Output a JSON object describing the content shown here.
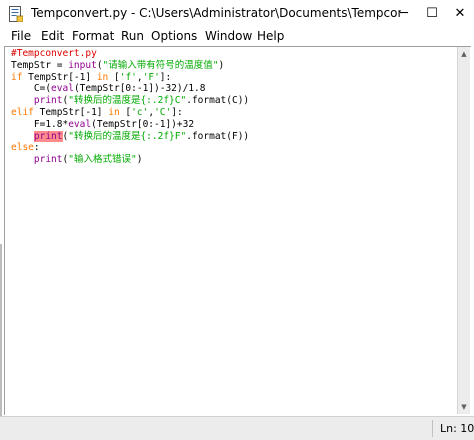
{
  "window": {
    "title": "Tempconvert.py - C:\\Users\\Administrator\\Documents\\Tempconvert.py ...",
    "controls": {
      "minimize": "─",
      "maximize": "☐",
      "close": "✕"
    }
  },
  "menu": [
    "File",
    "Edit",
    "Format",
    "Run",
    "Options",
    "Window",
    "Help"
  ],
  "code": {
    "l1": "#Tempconvert.py",
    "l2_a": "TempStr = ",
    "l2_b": "input",
    "l2_c": "(",
    "l2_d": "\"请输入带有符号的温度值\"",
    "l2_e": ")",
    "l3_a": "if",
    "l3_b": " TempStr[-1] ",
    "l3_c": "in",
    "l3_d": " [",
    "l3_e": "'f'",
    "l3_f": ",",
    "l3_g": "'F'",
    "l3_h": "]:",
    "l4_a": "    C=(",
    "l4_b": "eval",
    "l4_c": "(TempStr[0:-1])-32)/1.8",
    "l5_a": "    ",
    "l5_b": "print",
    "l5_c": "(",
    "l5_d": "\"转换后的温度是{:.2f}C\"",
    "l5_e": ".format(C))",
    "l6_a": "elif",
    "l6_b": " TempStr[-1] ",
    "l6_c": "in",
    "l6_d": " [",
    "l6_e": "'c'",
    "l6_f": ",",
    "l6_g": "'C'",
    "l6_h": "]:",
    "l7_a": "    F=1.8*",
    "l7_b": "eval",
    "l7_c": "(TempStr[0:-1])+32",
    "l8_a": "    ",
    "l8_b": "print",
    "l8_c": "(",
    "l8_d": "\"转换后的温度是{:.2f}F\"",
    "l8_e": ".format(F))",
    "l9_a": "else",
    "l9_b": ":",
    "l10_a": "    ",
    "l10_b": "print",
    "l10_c": "(",
    "l10_d": "\"输入格式错误\"",
    "l10_e": ")"
  },
  "colors": {
    "keyword": "#ff7700",
    "builtin": "#900090",
    "string": "#00aa00",
    "comment": "#dd0000",
    "error_highlight": "#ff8c8c"
  },
  "status": {
    "line_col": "Ln: 10"
  }
}
